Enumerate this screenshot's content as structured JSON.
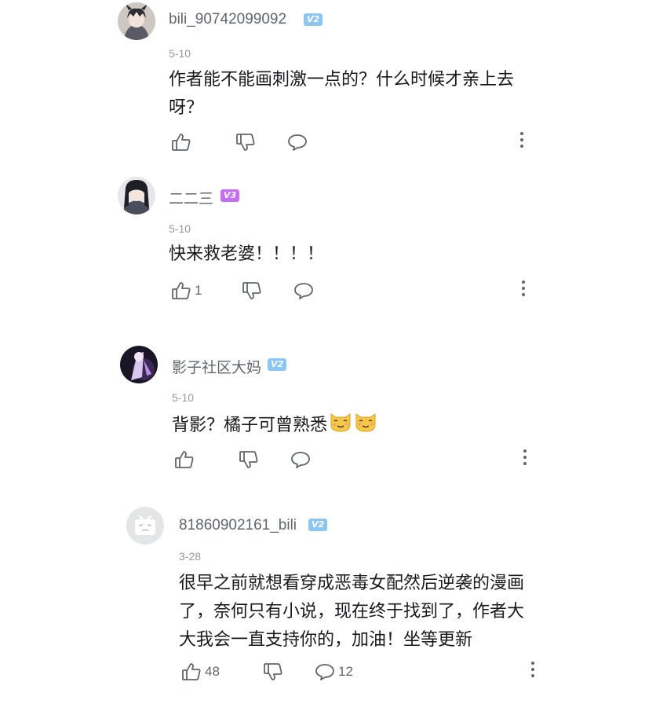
{
  "comments": [
    {
      "username": "bili_90742099092",
      "level": "V2",
      "date": "5-10",
      "text_line1": "作者能不能画刺激一点的？什么时候才亲上去",
      "text_line2": "呀？",
      "likes": "",
      "replies": ""
    },
    {
      "username": "二二三",
      "level": "V3",
      "date": "5-10",
      "text": "快来救老婆！！！！",
      "likes": "1",
      "replies": ""
    },
    {
      "username": "影子社区大妈",
      "level": "V2",
      "date": "5-10",
      "text": "背影？橘子可曾熟悉",
      "emojis": [
        "cat-face-emoji",
        "cat-face-emoji"
      ],
      "likes": "",
      "replies": ""
    },
    {
      "username": "81860902161_bili",
      "level": "V2",
      "date": "3-28",
      "text_line1": "很早之前就想看穿成恶毒女配然后逆袭的漫画",
      "text_line2": "了，奈何只有小说，现在终于找到了，作者大",
      "text_line3": "大我会一直支持你的，加油！坐等更新",
      "likes": "48",
      "replies": "12"
    }
  ],
  "colors": {
    "text": "#18191c",
    "secondary": "#61666d",
    "date": "#9499a0",
    "level2": "#8cc6f2",
    "level3": "#c56ef5"
  },
  "icons": [
    "thumb-up-icon",
    "thumb-down-icon",
    "reply-bubble-icon",
    "more-vertical-icon",
    "bilibili-tv-icon"
  ]
}
